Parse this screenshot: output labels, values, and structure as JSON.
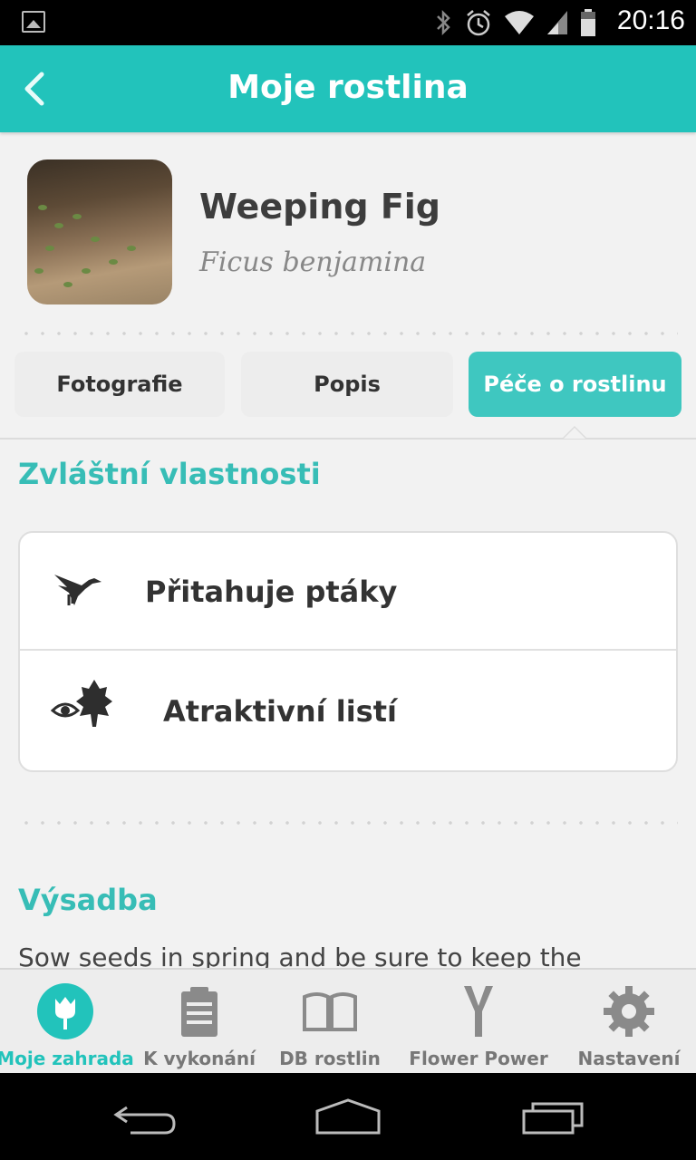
{
  "status_bar": {
    "time": "20:16"
  },
  "header": {
    "title": "Moje rostlina"
  },
  "plant": {
    "name": "Weeping Fig",
    "latin_name": "Ficus benjamina"
  },
  "tabs": [
    {
      "label": "Fotografie",
      "active": false
    },
    {
      "label": "Popis",
      "active": false
    },
    {
      "label": "Péče o rostlinu",
      "active": true
    }
  ],
  "sections": {
    "special": {
      "title": "Zvláštní vlastnosti",
      "features": [
        {
          "label": "Přitahuje ptáky",
          "icon": "bird-icon"
        },
        {
          "label": "Atraktivní listí",
          "icon": "eye-leaf-icon"
        }
      ]
    },
    "planting": {
      "title": "Výsadba",
      "text": "Sow seeds in spring and be sure to keep the"
    }
  },
  "bottom_nav": [
    {
      "label": "Moje zahrada",
      "icon": "tulip-icon",
      "active": true
    },
    {
      "label": "K vykonání",
      "icon": "clipboard-icon",
      "active": false
    },
    {
      "label": "DB rostlin",
      "icon": "book-icon",
      "active": false
    },
    {
      "label": "Flower Power",
      "icon": "sensor-icon",
      "active": false
    },
    {
      "label": "Nastavení",
      "icon": "gear-icon",
      "active": false
    }
  ],
  "colors": {
    "accent": "#22c3bb",
    "tab_active": "#3fc7c0",
    "text_dark": "#333333"
  }
}
